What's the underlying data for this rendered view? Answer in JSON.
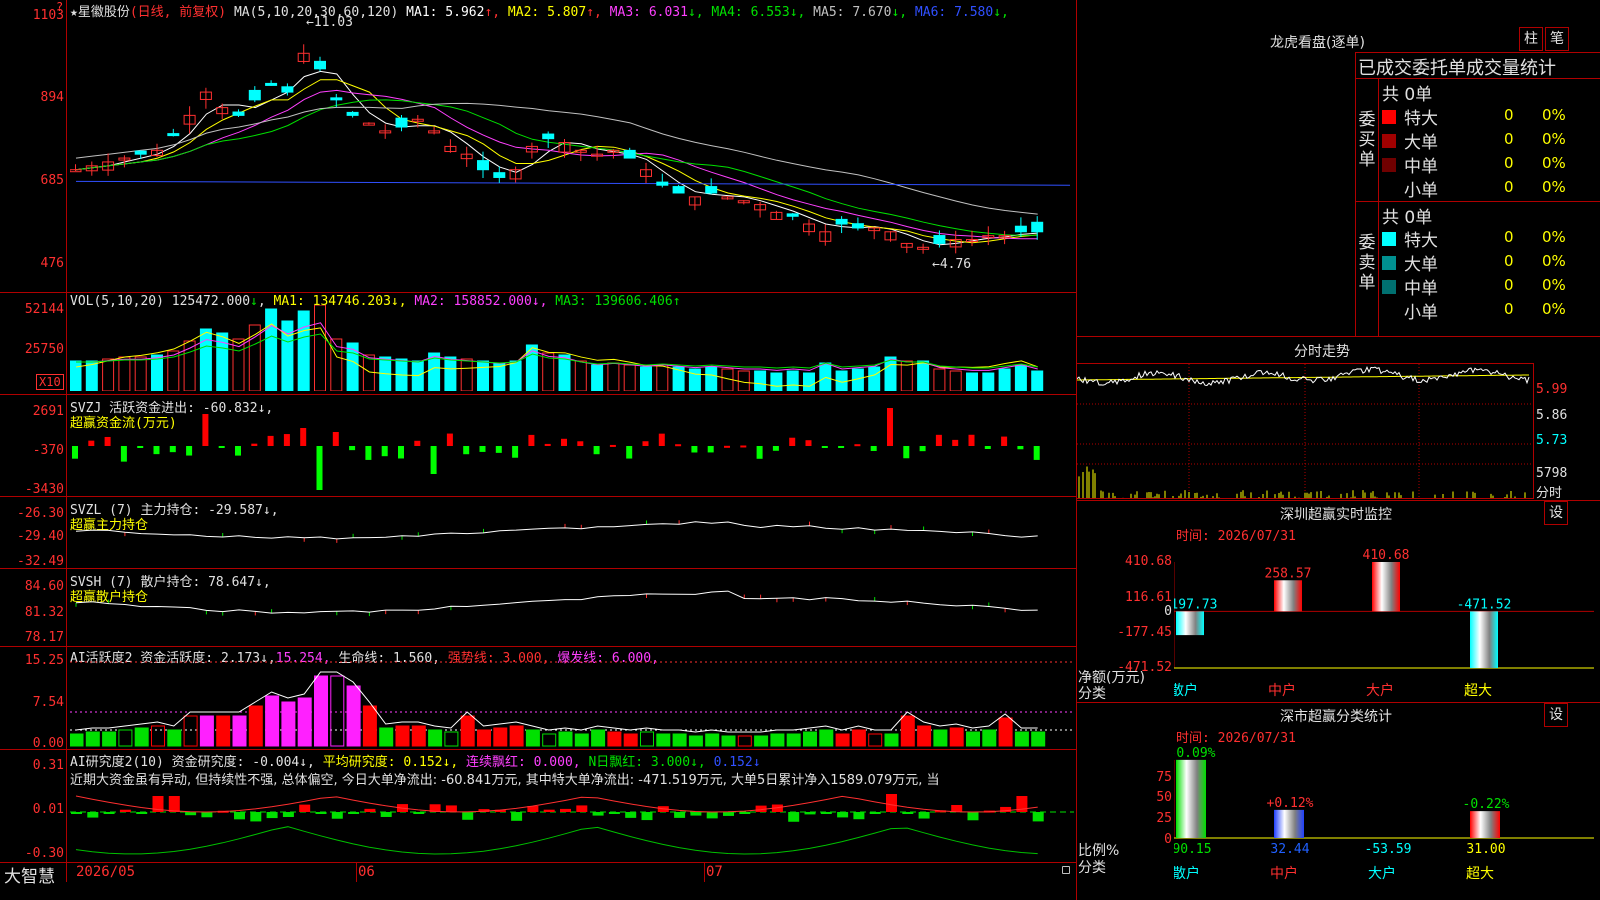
{
  "app": {
    "brand": "大智慧",
    "close_glyph": "?"
  },
  "main_chart": {
    "title": "★星徽股份",
    "period": "(日线, 前复权)",
    "ma_params": "MA(5,10,20,30,60,120)",
    "ma": [
      {
        "label": "MA1:",
        "value": "5.962",
        "arrow": "↑",
        "color": "#ffffff"
      },
      {
        "label": "MA2:",
        "value": "5.807",
        "arrow": "↑",
        "color": "#ffff00"
      },
      {
        "label": "MA3:",
        "value": "6.031",
        "arrow": "↓",
        "color": "#ff40ff"
      },
      {
        "label": "MA4:",
        "value": "6.553",
        "arrow": "↓",
        "color": "#00e000"
      },
      {
        "label": "MA5:",
        "value": "7.670",
        "arrow": "↓",
        "color": "#c0c0c0"
      },
      {
        "label": "MA6:",
        "value": "7.580",
        "arrow": "↓",
        "color": "#3050ff"
      }
    ],
    "y_ticks": [
      "1103",
      "894",
      "685",
      "476"
    ],
    "high_label": "11.03",
    "low_label": "4.76"
  },
  "vol_panel": {
    "params": "VOL(5,10,20)",
    "vol_value": "125472.000",
    "vol_arrow": "↓",
    "ma1": "MA1: 134746.203↓,",
    "ma2": "MA2: 158852.000↓,",
    "ma3": "MA3: 139606.406↑",
    "y_ticks": [
      "52144",
      "25750"
    ],
    "unit": "X10"
  },
  "svzj_panel": {
    "title": "SVZJ  活跃资金进出: -60.832↓,",
    "sub": "超赢资金流(万元)",
    "y_ticks": [
      "2691",
      "-370",
      "-3430"
    ]
  },
  "svzl_panel": {
    "title": "SVZL (7) 主力持仓: -29.587↓,",
    "sub": "超赢主力持仓",
    "y_ticks": [
      "-26.30",
      "-29.40",
      "-32.49"
    ]
  },
  "svsh_panel": {
    "title": "SVSH (7) 散户持仓: 78.647↓,",
    "sub": "超赢散户持仓",
    "y_ticks": [
      "84.60",
      "81.32",
      "78.17"
    ]
  },
  "ai1_panel": {
    "title": "AI活跃度2 资金活跃度: 2.173↓,",
    "v2": "15.254,",
    "life": "生命线: 1.560,",
    "strong": "强势线: 3.000,",
    "burst": "爆发线: 6.000,",
    "y_ticks": [
      "15.25",
      "7.54",
      "0.00"
    ]
  },
  "ai2_panel": {
    "title": "AI研究度2(10) 资金研究度: -0.004↓,",
    "avg": "平均研究度: 0.152↓,",
    "lianxu": "连续飘红: 0.000,",
    "nri": "N日飘红: 3.000↓,",
    "last": "0.152↓",
    "comment": "近期大资金虽有异动, 但持续性不强, 总体偏空, 今日大单净流出: -60.841万元, 其中特大单净流出: -471.519万元, 大单5日累计净入1589.079万元, 当",
    "y_ticks": [
      "0.31",
      "0.01",
      "-0.30"
    ]
  },
  "x_axis": [
    "2026/05",
    "06",
    "07"
  ],
  "dragon_tiger": {
    "title": "龙虎看盘(逐单)",
    "btn_bar": "柱",
    "btn_bi": "笔",
    "tabs": "已成交委托单成交量统计",
    "buy_label": "委买单",
    "sell_label": "委卖单",
    "buy_total": "共 0单",
    "sell_total": "共 0单",
    "buy_rows": [
      {
        "label": "特大",
        "value": "0",
        "pct": "0%",
        "color": "#ff0000"
      },
      {
        "label": "大单",
        "value": "0",
        "pct": "0%",
        "color": "#a00000"
      },
      {
        "label": "中单",
        "value": "0",
        "pct": "0%",
        "color": "#700000"
      },
      {
        "label": "小单",
        "value": "0",
        "pct": "0%",
        "color": ""
      }
    ],
    "sell_rows": [
      {
        "label": "特大",
        "value": "0",
        "pct": "0%",
        "color": "#00ffff"
      },
      {
        "label": "大单",
        "value": "0",
        "pct": "0%",
        "color": "#009090"
      },
      {
        "label": "中单",
        "value": "0",
        "pct": "0%",
        "color": "#007070"
      },
      {
        "label": "小单",
        "value": "0",
        "pct": "0%",
        "color": ""
      }
    ]
  },
  "intraday": {
    "title": "分时走势",
    "y_ticks": [
      "5.99",
      "5.86",
      "5.73"
    ],
    "vol_tick": "5798",
    "vol_label": "分时"
  },
  "sz_monitor": {
    "title": "深圳超赢实时监控",
    "btn": "设",
    "time": "时间: 2026/07/31",
    "y_ticks": [
      "410.68",
      "116.61",
      "0",
      "-177.45",
      "-471.52"
    ],
    "ylabel": "净额(万元)",
    "xlabel": "分类",
    "categories": [
      "散户",
      "中户",
      "大户",
      "超大"
    ]
  },
  "sz_stats": {
    "title": "深市超赢分类统计",
    "btn": "设",
    "time": "时间: 2026/07/31",
    "y_ticks": [
      "75",
      "50",
      "25",
      "0"
    ],
    "ylabel": "比例%",
    "xlabel": "分类",
    "categories": [
      "散户",
      "中户",
      "大户",
      "超大"
    ]
  },
  "chart_data": [
    {
      "type": "bar",
      "title": "深圳超赢实时监控",
      "ylabel": "净额(万元)",
      "xlabel": "分类",
      "categories": [
        "散户",
        "中户",
        "大户",
        "超大"
      ],
      "values": [
        -197.73,
        258.57,
        410.68,
        -471.52
      ],
      "labels": [
        "-197.73",
        "258.57",
        "410.68",
        "-471.52"
      ],
      "ylim": [
        -471.52,
        410.68
      ]
    },
    {
      "type": "bar",
      "title": "深市超赢分类统计",
      "ylabel": "比例%",
      "xlabel": "分类",
      "categories": [
        "散户",
        "中户",
        "大户",
        "超大"
      ],
      "values": [
        90.15,
        32.44,
        -53.59,
        31.0
      ],
      "top_labels": [
        "-0.09%",
        "+0.12%",
        "",
        "-0.22%"
      ],
      "bottom_labels": [
        "90.15",
        "32.44",
        "-53.59",
        "31.00"
      ],
      "ylim": [
        0,
        90
      ]
    }
  ]
}
